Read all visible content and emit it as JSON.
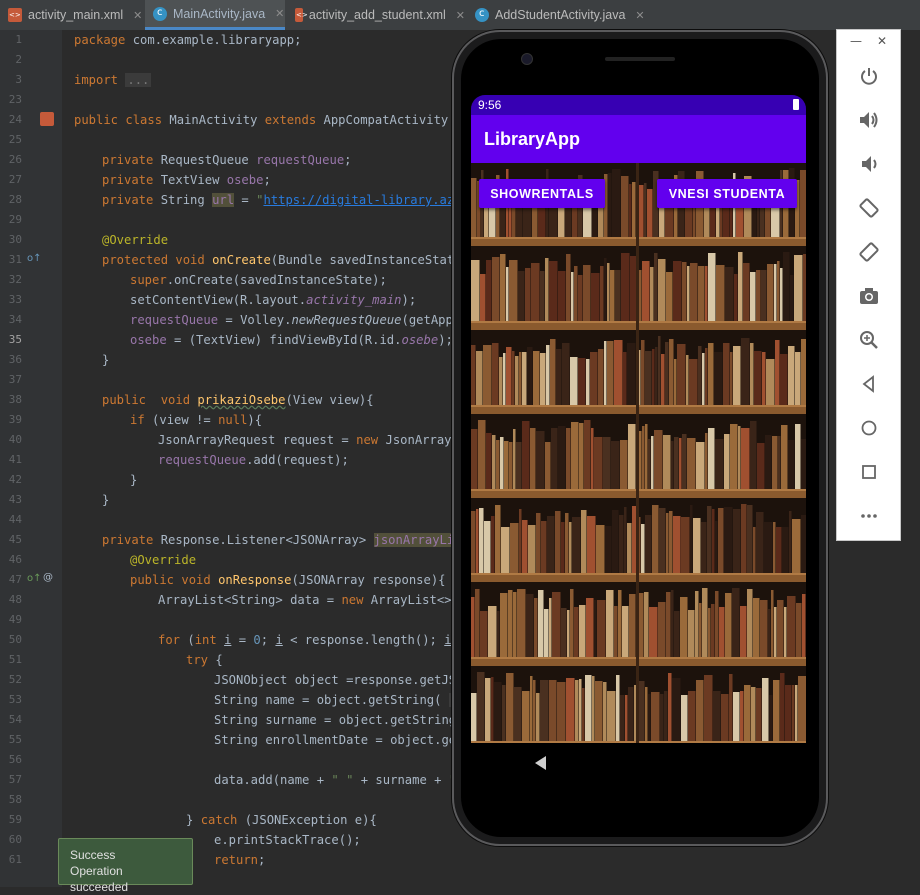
{
  "tabs": [
    {
      "label": "activity_main.xml",
      "type": "xml",
      "active": false
    },
    {
      "label": "MainActivity.java",
      "type": "class",
      "active": true
    },
    {
      "label": "activity_add_student.xml",
      "type": "xml",
      "active": false
    },
    {
      "label": "AddStudentActivity.java",
      "type": "class",
      "active": false
    }
  ],
  "code": {
    "current_line": "35",
    "lines": [
      {
        "n": "1"
      },
      {
        "n": "2"
      },
      {
        "n": "3"
      },
      {
        "n": "23"
      },
      {
        "n": "24"
      },
      {
        "n": "25"
      },
      {
        "n": "26"
      },
      {
        "n": "27"
      },
      {
        "n": "28"
      },
      {
        "n": "29"
      },
      {
        "n": "30"
      },
      {
        "n": "31"
      },
      {
        "n": "32"
      },
      {
        "n": "33"
      },
      {
        "n": "34"
      },
      {
        "n": "35"
      },
      {
        "n": "36"
      },
      {
        "n": "37"
      },
      {
        "n": "38"
      },
      {
        "n": "39"
      },
      {
        "n": "40"
      },
      {
        "n": "41"
      },
      {
        "n": "42"
      },
      {
        "n": "43"
      },
      {
        "n": "44"
      },
      {
        "n": "45"
      },
      {
        "n": "46"
      },
      {
        "n": "47"
      },
      {
        "n": "48"
      },
      {
        "n": "49"
      },
      {
        "n": "50"
      },
      {
        "n": "51"
      },
      {
        "n": "52"
      },
      {
        "n": "53"
      },
      {
        "n": "54"
      },
      {
        "n": "55"
      },
      {
        "n": "56"
      },
      {
        "n": "57"
      },
      {
        "n": "58"
      },
      {
        "n": "59"
      },
      {
        "n": "60"
      },
      {
        "n": "61"
      }
    ]
  },
  "toast": {
    "title": "Success",
    "message": "Operation succeeded"
  },
  "emulator": {
    "status_time": "9:56",
    "app_title": "LibraryApp",
    "buttons": {
      "show_rentals": "SHOWRENTALS",
      "add_student": "VNESI STUDENTA"
    }
  },
  "emulator_panel": {
    "minimize_icon": "minimize-icon",
    "close_icon": "close-icon",
    "tools": [
      "power-icon",
      "volume-up-icon",
      "volume-down-icon",
      "rotate-left-icon",
      "rotate-right-icon",
      "camera-icon",
      "zoom-icon",
      "back-icon",
      "home-icon",
      "overview-icon",
      "more-icon"
    ]
  },
  "colors": {
    "accent": "#6200ee",
    "status_bar": "#3700b3",
    "editor_bg": "#2b2b2b"
  }
}
